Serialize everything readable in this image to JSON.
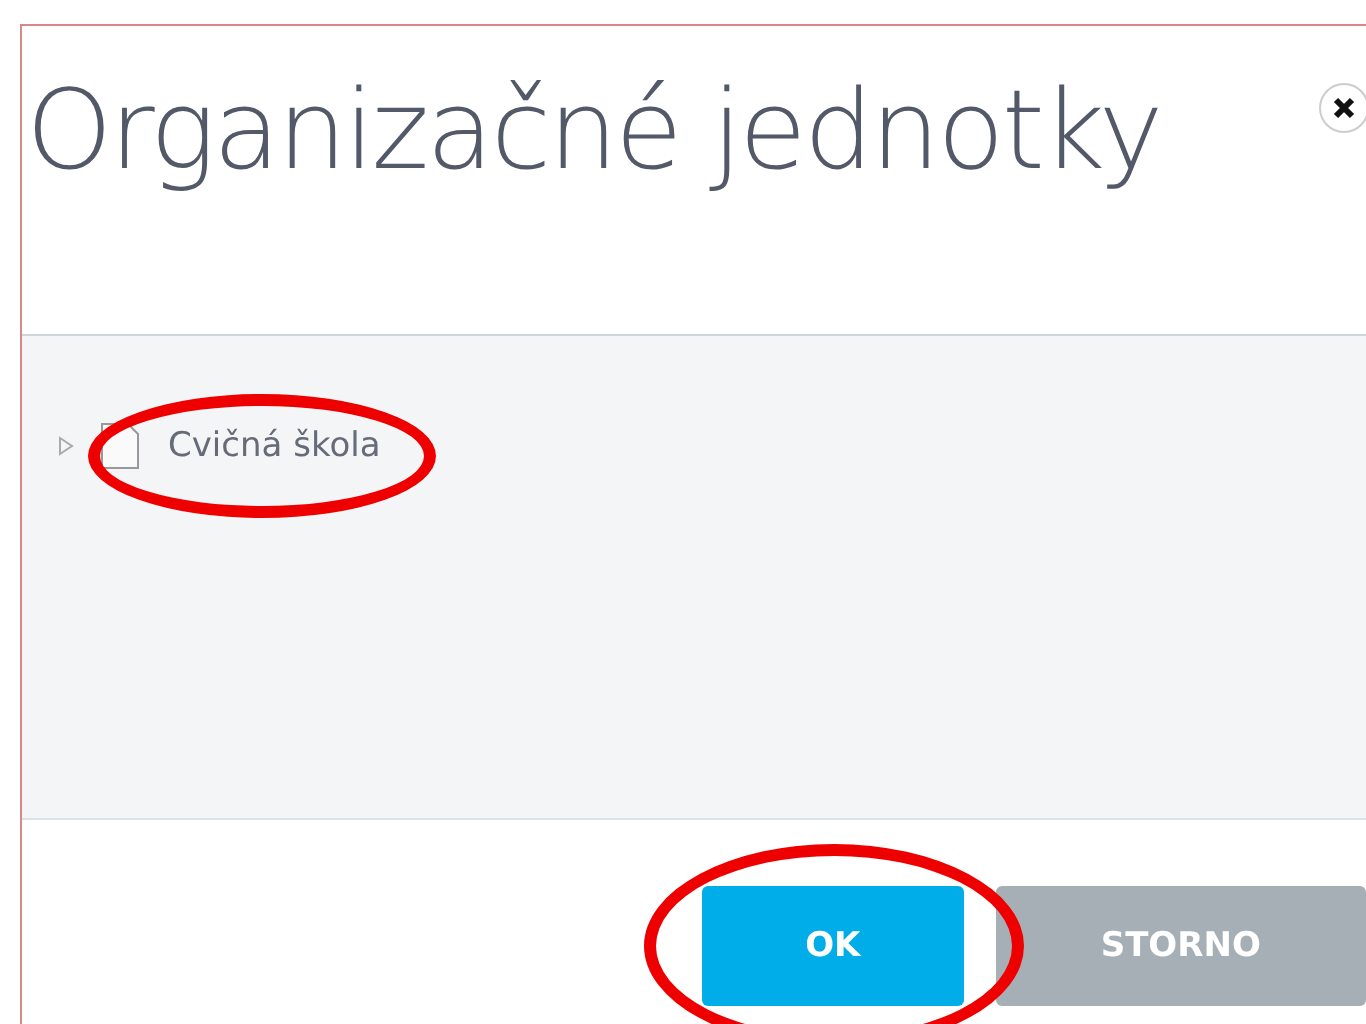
{
  "dialog": {
    "title": "Organizačné jednotky"
  },
  "tree": {
    "items": [
      {
        "label": "Cvičná škola",
        "expanded": false
      }
    ]
  },
  "buttons": [
    {
      "label": "OK",
      "kind": "primary"
    },
    {
      "label": "STORNO",
      "kind": "secondary"
    }
  ]
}
